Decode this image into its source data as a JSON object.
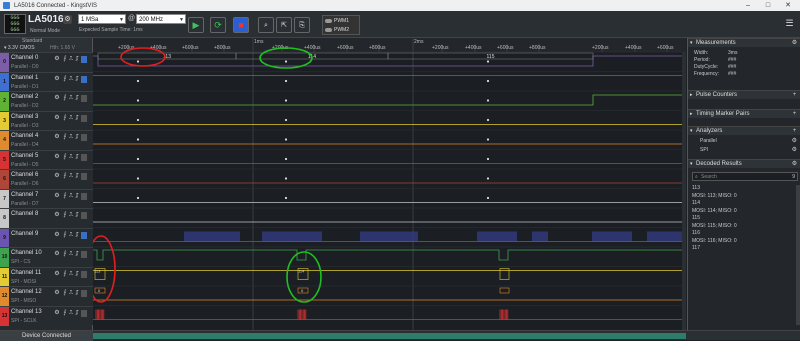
{
  "window": {
    "title": "LA5016 Connected - KingstVIS",
    "minimize": "–",
    "maximize": "□",
    "close": "✕"
  },
  "toolbar": {
    "logo_lines": [
      "GGG",
      "GGG",
      "GGG"
    ],
    "device_name": "LA5016",
    "device_mode": "Normal Mode",
    "sample_depth": "1 MSa",
    "sample_rate": "200 MHz",
    "expected_time": "Expected Sample Time: 1ms",
    "pwm1": "PWM1",
    "pwm2": "PWM2"
  },
  "left_panel": {
    "standard_label": "Standard",
    "threshold_label": "3.3V CMOS",
    "threshold_hint": "Hth: 1.65 V"
  },
  "channels": [
    {
      "num": "0",
      "name": "Channel 0",
      "sub": "Parallel - D0",
      "color": "#7b5ea7"
    },
    {
      "num": "1",
      "name": "Channel 1",
      "sub": "Parallel - D1",
      "color": "#3f6fd1"
    },
    {
      "num": "2",
      "name": "Channel 2",
      "sub": "Parallel - D2",
      "color": "#5fb233"
    },
    {
      "num": "3",
      "name": "Channel 3",
      "sub": "Parallel - D3",
      "color": "#e3cc33"
    },
    {
      "num": "4",
      "name": "Channel 4",
      "sub": "Parallel - D4",
      "color": "#e08a2e"
    },
    {
      "num": "5",
      "name": "Channel 5",
      "sub": "Parallel - D5",
      "color": "#d63434"
    },
    {
      "num": "6",
      "name": "Channel 6",
      "sub": "Parallel - D6",
      "color": "#b0453a"
    },
    {
      "num": "7",
      "name": "Channel 7",
      "sub": "Parallel - D7",
      "color": "#c7c7c7"
    },
    {
      "num": "8",
      "name": "Channel 8",
      "sub": "",
      "color": "#c7c7c7"
    },
    {
      "num": "9",
      "name": "Channel 9",
      "sub": "",
      "color": "#6b55b0"
    },
    {
      "num": "10",
      "name": "Channel 10",
      "sub": "SPI - CS",
      "color": "#3fa24e"
    },
    {
      "num": "11",
      "name": "Channel 11",
      "sub": "SPI - MOSI",
      "color": "#e3cc33"
    },
    {
      "num": "12",
      "name": "Channel 12",
      "sub": "SPI - MISO",
      "color": "#e08a2e"
    },
    {
      "num": "13",
      "name": "Channel 13",
      "sub": "SPI - SCLK",
      "color": "#d63434"
    }
  ],
  "timeline": {
    "major": [
      "1ms",
      "2ms"
    ],
    "minor": [
      "+200us",
      "+400us",
      "+600us",
      "+800us",
      "+200us",
      "+400us",
      "+600us",
      "+800us",
      "+200us",
      "+400us",
      "+600us",
      "+800us",
      "+200us",
      "+400us",
      "+600us"
    ]
  },
  "waveform_labels": {
    "bus_values": [
      "113",
      "114",
      "115"
    ],
    "spi_values_left": [
      "113",
      "0"
    ],
    "spi_values_mid": [
      "114",
      "0"
    ]
  },
  "right_panel": {
    "measurements_title": "Measurements",
    "measurements": [
      {
        "label": "Width:",
        "value": "3ms"
      },
      {
        "label": "Period:",
        "value": "###"
      },
      {
        "label": "DutyCycle:",
        "value": "###"
      },
      {
        "label": "Frequency:",
        "value": "###"
      }
    ],
    "pulse_counters_title": "Pulse Counters",
    "timing_marker_title": "Timing Marker Pairs",
    "analyzers_title": "Analyzers",
    "analyzers": [
      "Parallel",
      "SPI"
    ],
    "decoded_title": "Decoded Results",
    "search_placeholder": "Search",
    "search_count": "9",
    "decoded_lines": [
      "113",
      "MOSI: 113;   MISO: 0",
      "114",
      "MOSI: 114;   MISO: 0",
      "115",
      "MOSI: 115;   MISO: 0",
      "116",
      "MOSI: 116;   MISO: 0",
      "117"
    ]
  },
  "status": {
    "device_connected": "Device Connected"
  },
  "colors": {
    "annotation_red": "#e02020",
    "annotation_green": "#20c020"
  }
}
